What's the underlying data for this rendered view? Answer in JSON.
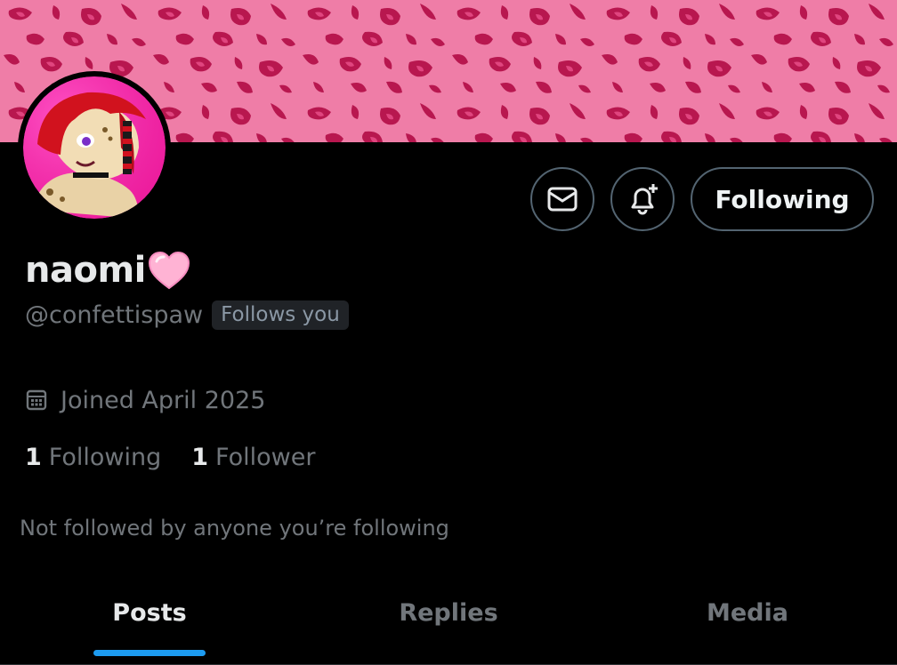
{
  "profile": {
    "display_name": "naomi",
    "handle": "@confettispaw",
    "follows_you_badge": "Follows you",
    "joined": "Joined April 2025",
    "following_count": "1",
    "following_label": "Following",
    "followers_count": "1",
    "followers_label": "Follower",
    "mutuals_note": "Not followed by anyone you’re following"
  },
  "actions": {
    "following_button_label": "Following",
    "message_icon": "envelope-icon",
    "notify_icon": "bell-plus-icon"
  },
  "tabs": [
    {
      "label": "Posts",
      "active": true
    },
    {
      "label": "Replies",
      "active": false
    },
    {
      "label": "Media",
      "active": false
    }
  ],
  "colors": {
    "accent": "#1d9bf0",
    "banner_base": "#ef7da7",
    "banner_spots": "#b8174f",
    "heart": "#ffc1dc"
  }
}
